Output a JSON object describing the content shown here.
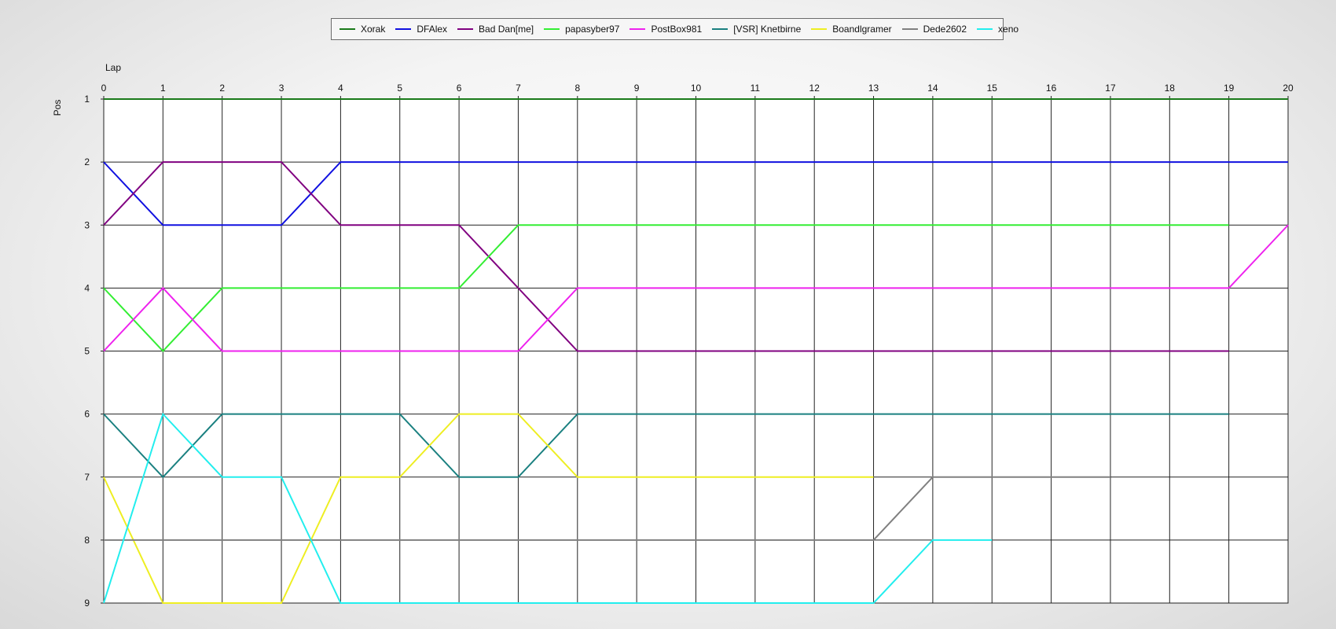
{
  "chart_data": {
    "type": "line",
    "xlabel": "Lap",
    "ylabel": "Pos",
    "x_axis_position": "top",
    "y_inverted": true,
    "grid": true,
    "legend_position": "top-center",
    "xlim": [
      0,
      20
    ],
    "ylim": [
      1,
      9
    ],
    "x_ticks": [
      0,
      1,
      2,
      3,
      4,
      5,
      6,
      7,
      8,
      9,
      10,
      11,
      12,
      13,
      14,
      15,
      16,
      17,
      18,
      19,
      20
    ],
    "y_ticks": [
      1,
      2,
      3,
      4,
      5,
      6,
      7,
      8,
      9
    ],
    "series": [
      {
        "name": "Xorak",
        "color": "#1a7a1a",
        "points": [
          [
            0,
            1
          ],
          [
            1,
            1
          ],
          [
            2,
            1
          ],
          [
            3,
            1
          ],
          [
            4,
            1
          ],
          [
            5,
            1
          ],
          [
            6,
            1
          ],
          [
            7,
            1
          ],
          [
            8,
            1
          ],
          [
            9,
            1
          ],
          [
            10,
            1
          ],
          [
            11,
            1
          ],
          [
            12,
            1
          ],
          [
            13,
            1
          ],
          [
            14,
            1
          ],
          [
            15,
            1
          ],
          [
            16,
            1
          ],
          [
            17,
            1
          ],
          [
            18,
            1
          ],
          [
            19,
            1
          ],
          [
            20,
            1
          ]
        ]
      },
      {
        "name": "DFAlex",
        "color": "#1010e0",
        "points": [
          [
            0,
            2
          ],
          [
            1,
            3
          ],
          [
            2,
            3
          ],
          [
            3,
            3
          ],
          [
            4,
            2
          ],
          [
            5,
            2
          ],
          [
            6,
            2
          ],
          [
            7,
            2
          ],
          [
            8,
            2
          ],
          [
            9,
            2
          ],
          [
            10,
            2
          ],
          [
            11,
            2
          ],
          [
            12,
            2
          ],
          [
            13,
            2
          ],
          [
            14,
            2
          ],
          [
            15,
            2
          ],
          [
            16,
            2
          ],
          [
            17,
            2
          ],
          [
            18,
            2
          ],
          [
            19,
            2
          ],
          [
            20,
            2
          ]
        ]
      },
      {
        "name": "Bad Dan[me]",
        "color": "#800080",
        "points": [
          [
            0,
            3
          ],
          [
            1,
            2
          ],
          [
            2,
            2
          ],
          [
            3,
            2
          ],
          [
            4,
            3
          ],
          [
            5,
            3
          ],
          [
            6,
            3
          ],
          [
            7,
            4
          ],
          [
            8,
            5
          ],
          [
            9,
            5
          ],
          [
            10,
            5
          ],
          [
            11,
            5
          ],
          [
            12,
            5
          ],
          [
            13,
            5
          ],
          [
            14,
            5
          ],
          [
            15,
            5
          ],
          [
            16,
            5
          ],
          [
            17,
            5
          ],
          [
            18,
            5
          ],
          [
            19,
            5
          ]
        ]
      },
      {
        "name": "papasyber97",
        "color": "#33ee33",
        "points": [
          [
            0,
            4
          ],
          [
            1,
            5
          ],
          [
            2,
            4
          ],
          [
            3,
            4
          ],
          [
            4,
            4
          ],
          [
            5,
            4
          ],
          [
            6,
            4
          ],
          [
            7,
            3
          ],
          [
            8,
            3
          ],
          [
            9,
            3
          ],
          [
            10,
            3
          ],
          [
            11,
            3
          ],
          [
            12,
            3
          ],
          [
            13,
            3
          ],
          [
            14,
            3
          ],
          [
            15,
            3
          ],
          [
            16,
            3
          ],
          [
            17,
            3
          ],
          [
            18,
            3
          ],
          [
            19,
            3
          ]
        ]
      },
      {
        "name": "PostBox981",
        "color": "#ee22ee",
        "points": [
          [
            0,
            5
          ],
          [
            1,
            4
          ],
          [
            2,
            5
          ],
          [
            3,
            5
          ],
          [
            4,
            5
          ],
          [
            5,
            5
          ],
          [
            6,
            5
          ],
          [
            7,
            5
          ],
          [
            8,
            4
          ],
          [
            9,
            4
          ],
          [
            10,
            4
          ],
          [
            11,
            4
          ],
          [
            12,
            4
          ],
          [
            13,
            4
          ],
          [
            14,
            4
          ],
          [
            15,
            4
          ],
          [
            16,
            4
          ],
          [
            17,
            4
          ],
          [
            18,
            4
          ],
          [
            19,
            4
          ],
          [
            20,
            3
          ]
        ]
      },
      {
        "name": "[VSR] Knetbirne",
        "color": "#1a8080",
        "points": [
          [
            0,
            6
          ],
          [
            1,
            7
          ],
          [
            2,
            6
          ],
          [
            3,
            6
          ],
          [
            4,
            6
          ],
          [
            5,
            6
          ],
          [
            6,
            7
          ],
          [
            7,
            7
          ],
          [
            8,
            6
          ],
          [
            9,
            6
          ],
          [
            10,
            6
          ],
          [
            11,
            6
          ],
          [
            12,
            6
          ],
          [
            13,
            6
          ],
          [
            14,
            6
          ],
          [
            15,
            6
          ],
          [
            16,
            6
          ],
          [
            17,
            6
          ],
          [
            18,
            6
          ],
          [
            19,
            6
          ]
        ]
      },
      {
        "name": "Boandlgramer",
        "color": "#eeee22",
        "points": [
          [
            0,
            7
          ],
          [
            1,
            9
          ],
          [
            2,
            9
          ],
          [
            3,
            9
          ],
          [
            4,
            7
          ],
          [
            5,
            7
          ],
          [
            6,
            6
          ],
          [
            7,
            6
          ],
          [
            8,
            7
          ],
          [
            9,
            7
          ],
          [
            10,
            7
          ],
          [
            11,
            7
          ],
          [
            12,
            7
          ],
          [
            13,
            7
          ]
        ]
      },
      {
        "name": "Dede2602",
        "color": "#808080",
        "points": [
          [
            0,
            8
          ],
          [
            1,
            8
          ],
          [
            2,
            8
          ],
          [
            3,
            8
          ],
          [
            4,
            8
          ],
          [
            5,
            8
          ],
          [
            6,
            8
          ],
          [
            7,
            8
          ],
          [
            8,
            8
          ],
          [
            9,
            8
          ],
          [
            10,
            8
          ],
          [
            11,
            8
          ],
          [
            12,
            8
          ],
          [
            13,
            8
          ],
          [
            14,
            7
          ],
          [
            15,
            7
          ],
          [
            16,
            7
          ],
          [
            17,
            7
          ]
        ]
      },
      {
        "name": "xeno",
        "color": "#22eeee",
        "points": [
          [
            0,
            9
          ],
          [
            1,
            6
          ],
          [
            2,
            7
          ],
          [
            3,
            7
          ],
          [
            4,
            9
          ],
          [
            5,
            9
          ],
          [
            6,
            9
          ],
          [
            7,
            9
          ],
          [
            8,
            9
          ],
          [
            9,
            9
          ],
          [
            10,
            9
          ],
          [
            11,
            9
          ],
          [
            12,
            9
          ],
          [
            13,
            9
          ],
          [
            14,
            8
          ],
          [
            15,
            8
          ]
        ]
      }
    ]
  }
}
